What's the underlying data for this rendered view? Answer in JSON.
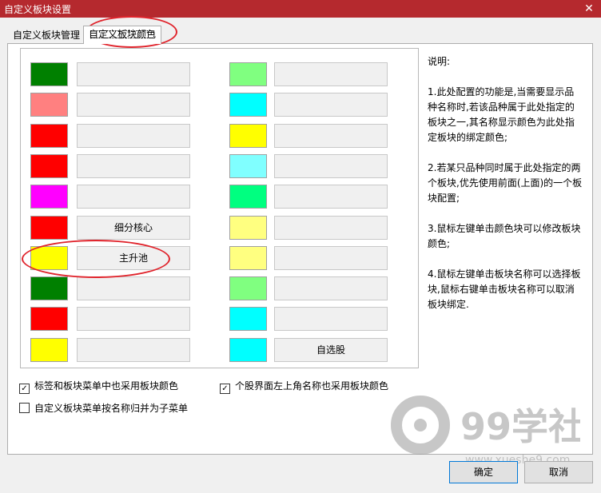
{
  "window": {
    "title": "自定义板块设置",
    "close_glyph": "✕"
  },
  "tabs": [
    {
      "label": "自定义板块管理",
      "active": false
    },
    {
      "label": "自定义板块颜色",
      "active": true
    }
  ],
  "colors": {
    "green": "#008000",
    "pink": "#ff8080",
    "red": "#ff0000",
    "magenta": "#ff00ff",
    "yellow": "#ffff00",
    "lightgreen": "#80ff80",
    "cyan": "#00ffff",
    "lightcyan": "#80ffff",
    "springgreen": "#00ff80",
    "paleyellow": "#ffff80",
    "annotation": "#e0242c"
  },
  "left_column": [
    {
      "swatch_color": "#008000",
      "name": ""
    },
    {
      "swatch_color": "#ff8080",
      "name": ""
    },
    {
      "swatch_color": "#ff0000",
      "name": ""
    },
    {
      "swatch_color": "#ff0000",
      "name": ""
    },
    {
      "swatch_color": "#ff00ff",
      "name": ""
    },
    {
      "swatch_color": "#ff0000",
      "name": "细分核心"
    },
    {
      "swatch_color": "#ffff00",
      "name": "主升池"
    },
    {
      "swatch_color": "#008000",
      "name": ""
    },
    {
      "swatch_color": "#ff0000",
      "name": ""
    },
    {
      "swatch_color": "#ffff00",
      "name": ""
    }
  ],
  "right_column": [
    {
      "swatch_color": "#80ff80",
      "name": ""
    },
    {
      "swatch_color": "#00ffff",
      "name": ""
    },
    {
      "swatch_color": "#ffff00",
      "name": ""
    },
    {
      "swatch_color": "#80ffff",
      "name": ""
    },
    {
      "swatch_color": "#00ff80",
      "name": ""
    },
    {
      "swatch_color": "#ffff80",
      "name": ""
    },
    {
      "swatch_color": "#ffff80",
      "name": ""
    },
    {
      "swatch_color": "#80ff80",
      "name": ""
    },
    {
      "swatch_color": "#00ffff",
      "name": ""
    },
    {
      "swatch_color": "#00ffff",
      "name": "自选股"
    }
  ],
  "notes": [
    "说明:",
    "1.此处配置的功能是,当需要显示品种名称时,若该品种属于此处指定的板块之一,其名称显示颜色为此处指定板块的绑定颜色;",
    "2.若某只品种同时属于此处指定的两个板块,优先使用前面(上面)的一个板块配置;",
    "3.鼠标左键单击颜色块可以修改板块颜色;",
    "4.鼠标左键单击板块名称可以选择板块,鼠标右键单击板块名称可以取消板块绑定."
  ],
  "options": [
    {
      "label": "标签和板块菜单中也采用板块颜色",
      "checked": true,
      "check_glyph": "✓"
    },
    {
      "label": "个股界面左上角名称也采用板块颜色",
      "checked": true,
      "check_glyph": "✓"
    },
    {
      "label": "自定义板块菜单按名称归并为子菜单",
      "checked": false,
      "check_glyph": ""
    }
  ],
  "buttons": {
    "ok": "确定",
    "cancel": "取消"
  },
  "watermark": {
    "brand": "99学社",
    "url": "www.xueshe9.com"
  }
}
